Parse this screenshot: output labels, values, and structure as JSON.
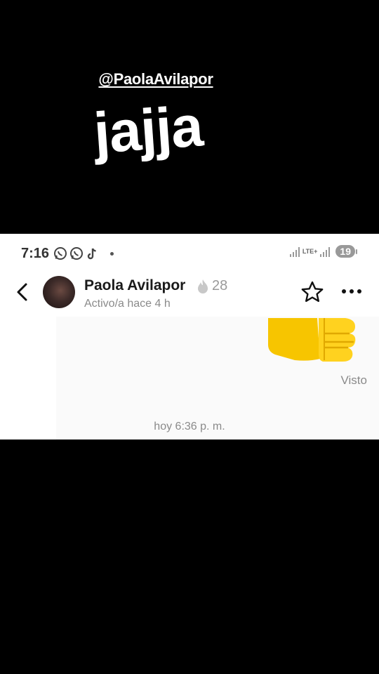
{
  "overlay": {
    "mention": "@PaolaAvilapor",
    "caption": "jajja"
  },
  "status_bar": {
    "time": "7:16",
    "icons": [
      "whatsapp-icon",
      "whatsapp-icon",
      "tiktok-icon"
    ],
    "network": "LTE+",
    "battery": "19"
  },
  "chat": {
    "contact_name": "Paola Avilapor",
    "streak_count": "28",
    "contact_status": "Activo/a hace 4 h",
    "seen_label": "Visto",
    "message_time": "hoy 6:36 p. m."
  }
}
